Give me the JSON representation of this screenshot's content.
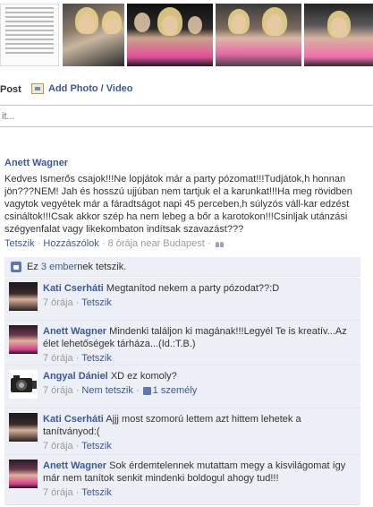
{
  "photos": [
    {
      "name": "photo-1"
    },
    {
      "name": "photo-2"
    },
    {
      "name": "photo-3"
    },
    {
      "name": "photo-4"
    },
    {
      "name": "photo-5"
    }
  ],
  "composer": {
    "post_label": "Post",
    "photo_label": "Add Photo / Video",
    "input_placeholder": "it..."
  },
  "post": {
    "author": "Anett Wagner",
    "text": "Kedves Ismerős csajok!!!Ne lopjátok már a party pózomat!!!Tudjátok,h honnan jön???NEM! Jah és hosszú ujjúban nem tartjuk el a karunkat!!!Ha meg rövidben vagytok vegyétek már a fáradtságot napi 45 perceben,h súlyzós váll-kar edzést csináltok!!!Csak akkor szép ha nem lebeg a bőr a karotokon!!!Csinljak utánzási szégyenfalat vagy likekombaton indítsak szavazást???",
    "like_link": "Tetszik",
    "sep1": " · ",
    "comment_link": "Hozzászólok",
    "sep2": " · ",
    "time_location": "8 órája near Budapest",
    "sep3": " · "
  },
  "likes": {
    "prefix": "Ez ",
    "count_link": "3 ember",
    "suffix": "nek tetszik."
  },
  "comments": [
    {
      "author": "Kati Cserháti",
      "text": "Megtanítod nekem a party pózodat??:D",
      "time": "7 órája",
      "sep": " · ",
      "action": "Tetszik",
      "avatar": "av-dark"
    },
    {
      "author": "Anett Wagner",
      "text": "Mindenki találjon ki magának!!!Legyél Te is kreatív...Az élet lehetőségek tárháza...(Id.:T.B.)",
      "time": "7 órája",
      "sep": " · ",
      "action": "Tetszik",
      "avatar": "av-pink"
    },
    {
      "author": "Angyal Dániel",
      "text": "XD ez komoly?",
      "time": "7 órája",
      "sep": " · ",
      "action": "Nem tetszik",
      "sep2": " · ",
      "likes": "1 személy",
      "avatar": "av-cam"
    },
    {
      "author": "Kati Cserháti",
      "text": "Ajjj most szomorú lettem azt hittem lehetek a tanítványod:(",
      "time": "7 órája",
      "sep": " · ",
      "action": "Tetszik",
      "avatar": "av-dark"
    },
    {
      "author": "Anett Wagner",
      "text": "Sok érdemtelennek mutattam megy a kisvilágomat így már nem tanítok senkit mindenki boldogul ahogy tud!!!",
      "time": "7 órája",
      "sep": " · ",
      "action": "Tetszik",
      "avatar": "av-pink"
    }
  ]
}
